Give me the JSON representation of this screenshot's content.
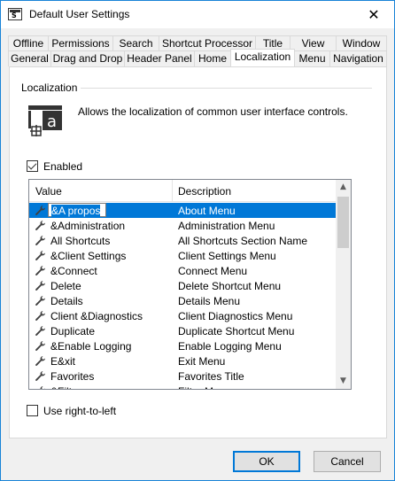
{
  "window": {
    "title": "Default User Settings",
    "icon": "app-settings-icon",
    "close_glyph": "✕"
  },
  "tabs": {
    "row1": [
      "Offline",
      "Permissions",
      "Search",
      "Shortcut Processor",
      "Title",
      "View",
      "Window"
    ],
    "row2": [
      "General",
      "Drag and Drop",
      "Header Panel",
      "Home",
      "Localization",
      "Menu",
      "Navigation"
    ],
    "active": "Localization"
  },
  "localization": {
    "group_label": "Localization",
    "description": "Allows the localization of common user interface controls.",
    "enabled_label": "Enabled",
    "enabled_checked": true,
    "columns": {
      "value": "Value",
      "description": "Description"
    },
    "rows": [
      {
        "value": "&A propos",
        "description": "About Menu",
        "selected": true
      },
      {
        "value": "&Administration",
        "description": "Administration Menu"
      },
      {
        "value": "All Shortcuts",
        "description": "All Shortcuts Section Name"
      },
      {
        "value": "&Client Settings",
        "description": "Client Settings Menu"
      },
      {
        "value": "&Connect",
        "description": "Connect Menu"
      },
      {
        "value": "Delete",
        "description": "Delete Shortcut Menu"
      },
      {
        "value": "Details",
        "description": "Details Menu"
      },
      {
        "value": "Client &Diagnostics",
        "description": "Client Diagnostics Menu"
      },
      {
        "value": "Duplicate",
        "description": "Duplicate Shortcut Menu"
      },
      {
        "value": "&Enable Logging",
        "description": "Enable Logging Menu"
      },
      {
        "value": "E&xit",
        "description": "Exit Menu"
      },
      {
        "value": "Favorites",
        "description": "Favorites Title"
      },
      {
        "value": "&Filter",
        "description": "Filter Menu"
      }
    ],
    "rtl_label": "Use right-to-left",
    "rtl_checked": false
  },
  "footer": {
    "ok_label": "OK",
    "cancel_label": "Cancel"
  },
  "colors": {
    "selection": "#0078d7",
    "window_border": "#1883d7"
  }
}
